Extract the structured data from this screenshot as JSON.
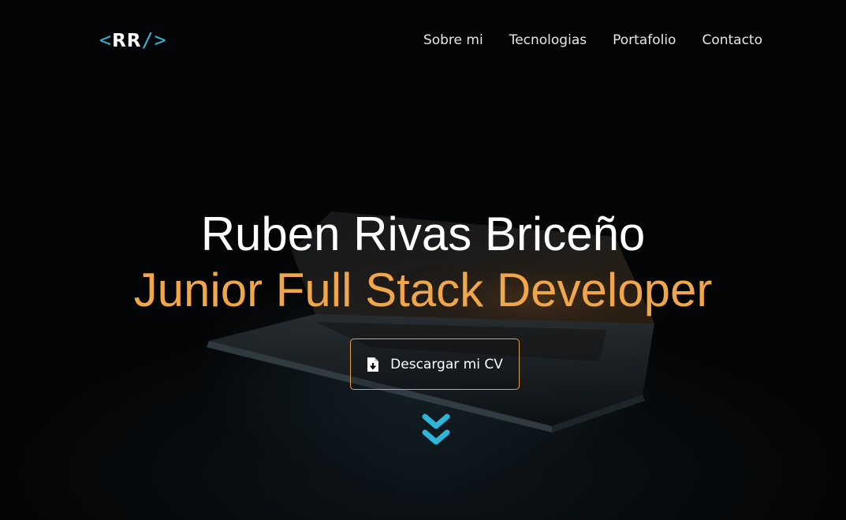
{
  "logo": {
    "open": "<",
    "text": "RR",
    "close": "/>"
  },
  "nav": {
    "items": [
      {
        "label": "Sobre mi"
      },
      {
        "label": "Tecnologias"
      },
      {
        "label": "Portafolio"
      },
      {
        "label": "Contacto"
      }
    ]
  },
  "hero": {
    "name": "Ruben Rivas Briceño",
    "role": "Junior Full Stack Developer",
    "cv_button": "Descargar mi CV"
  },
  "icons": {
    "cv": "file-download-icon",
    "scroll": "double-chevron-down-icon"
  },
  "colors": {
    "accent_cyan": "#2fb6d6",
    "accent_orange": "#f0a64a",
    "background": "#040506"
  }
}
